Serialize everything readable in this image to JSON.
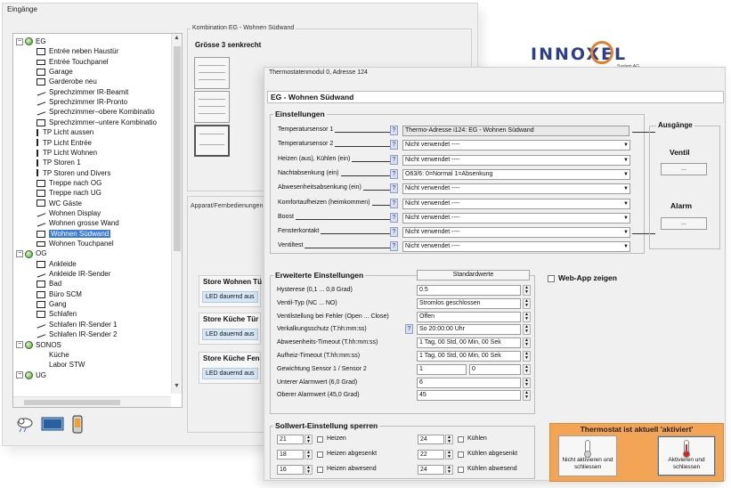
{
  "back_window": {
    "title": "Eingänge",
    "kombination_group_label": "Kombination EG - Wohnen Südwand",
    "kombination_subtitle": "Grösse 3 senkrecht",
    "apparat_group_label": "Apparat/Fernbedienungen",
    "tree": [
      {
        "label": "EG",
        "level": 0,
        "type": "group"
      },
      {
        "label": "Entrée neben Haustür",
        "level": 1,
        "type": "panel"
      },
      {
        "label": "Entrée Touchpanel",
        "level": 1,
        "type": "tp"
      },
      {
        "label": "Garage",
        "level": 1,
        "type": "panel"
      },
      {
        "label": "Garderobe neu",
        "level": 1,
        "type": "panel"
      },
      {
        "label": "Sprechzimmer IR-Beamit",
        "level": 1,
        "type": "line"
      },
      {
        "label": "Sprechzimmer IR-Pronto",
        "level": 1,
        "type": "line"
      },
      {
        "label": "Sprechzimmer–obere Kombinatio",
        "level": 1,
        "type": "line"
      },
      {
        "label": "Sprechzimmer–untere Kombinatio",
        "level": 1,
        "type": "panel"
      },
      {
        "label": "TP Licht aussen",
        "level": 1,
        "type": "bar"
      },
      {
        "label": "TP Licht Entrée",
        "level": 1,
        "type": "bar"
      },
      {
        "label": "TP Licht Wohnen",
        "level": 1,
        "type": "bar"
      },
      {
        "label": "TP Storen 1",
        "level": 1,
        "type": "bar"
      },
      {
        "label": "TP Storen und Divers",
        "level": 1,
        "type": "bar"
      },
      {
        "label": "Treppe nach OG",
        "level": 1,
        "type": "panel"
      },
      {
        "label": "Treppe nach UG",
        "level": 1,
        "type": "panel"
      },
      {
        "label": "WC Gäste",
        "level": 1,
        "type": "panel"
      },
      {
        "label": "Wohnen Display",
        "level": 1,
        "type": "line"
      },
      {
        "label": "Wohnen grosse Wand",
        "level": 1,
        "type": "line"
      },
      {
        "label": "Wohnen Südwand",
        "level": 1,
        "type": "panel",
        "selected": true
      },
      {
        "label": "Wohnen Touchpanel",
        "level": 1,
        "type": "tp"
      },
      {
        "label": "OG",
        "level": 0,
        "type": "group"
      },
      {
        "label": "Ankleide",
        "level": 1,
        "type": "panel"
      },
      {
        "label": "Ankleide IR-Sender",
        "level": 1,
        "type": "line"
      },
      {
        "label": "Bad",
        "level": 1,
        "type": "panel"
      },
      {
        "label": "Büro SCM",
        "level": 1,
        "type": "panel"
      },
      {
        "label": "Gang",
        "level": 1,
        "type": "panel"
      },
      {
        "label": "Schlafen",
        "level": 1,
        "type": "panel"
      },
      {
        "label": "Schlafen IR-Sender 1",
        "level": 1,
        "type": "line"
      },
      {
        "label": "Schlafen IR-Sender 2",
        "level": 1,
        "type": "line"
      },
      {
        "label": "SONOS",
        "level": 0,
        "type": "group"
      },
      {
        "label": "Küche",
        "level": 1,
        "type": "none"
      },
      {
        "label": "Labor STW",
        "level": 1,
        "type": "none"
      },
      {
        "label": "UG",
        "level": 0,
        "type": "group"
      }
    ],
    "store_cards": [
      {
        "title": "Store Wohnen Tü",
        "value": "LED dauernd aus"
      },
      {
        "title": "Store Küche Tür",
        "value": "LED dauernd aus"
      },
      {
        "title": "Store Küche Fen",
        "value": "LED dauernd aus"
      }
    ],
    "bottom_icons": [
      "weather-icon",
      "screen-icon",
      "phone-icon"
    ]
  },
  "logo": {
    "word": "INNOXEL",
    "sub": "System AG"
  },
  "front_window": {
    "title": "Thermostatenmodul 0, Adresse 124",
    "header": "EG - Wohnen Südwand",
    "einstellungen_label": "Einstellungen",
    "einstellungen": [
      {
        "label": "Temperatursensor 1",
        "value": "Thermo-Adresse i124: EG - Wohnen Südwand",
        "disabled": true
      },
      {
        "label": "Temperatursensor 2",
        "value": "Nicht verwendet ----"
      },
      {
        "label": "Heizen (aus), Kühlen (ein)",
        "value": "Nicht verwendet ----"
      },
      {
        "label": "Nachtabsenkung (ein)",
        "value": "O63/6: 0=Normal 1=Absenkung"
      },
      {
        "label": "Abwesenheitsabsenkung (ein)",
        "value": "Nicht verwendet ----"
      },
      {
        "label": "Komfortaufheizen (heimkommen)",
        "value": "Nicht verwendet ----"
      },
      {
        "label": "Boost",
        "value": "Nicht verwendet ----"
      },
      {
        "label": "Fensterkontakt",
        "value": "Nicht verwendet ----"
      },
      {
        "label": "Ventiltest",
        "value": "Nicht verwendet ----"
      }
    ],
    "ausgaenge_label": "Ausgänge",
    "ausgaenge": [
      {
        "label": "Ventil",
        "button": "..."
      },
      {
        "label": "Alarm",
        "button": "..."
      }
    ],
    "erweitert_label": "Erweiterte Einstellungen",
    "standard_button": "Standardwerte",
    "erweitert": [
      {
        "label": "Hysterese (0,1 ... 0,8 Grad)",
        "value": "0.5"
      },
      {
        "label": "Ventil-Typ (NC ... NO)",
        "value": "Stromlos geschlossen"
      },
      {
        "label": "Ventilstellung bei Fehler (Open ... Close)",
        "value": "Offen"
      },
      {
        "label": "Verkalkungsschutz (T.hh:mm:ss)",
        "value": "So 20:00:00 Uhr",
        "help": true
      },
      {
        "label": "Abwesenheits-Timeout (T.hh:mm:ss)",
        "value": "1 Tag, 00 Std, 00 Min, 00 Sek"
      },
      {
        "label": "Aufheiz-Timeout (T.hh:mm:ss)",
        "value": "1 Tag, 00 Std, 00 Min, 00 Sek"
      },
      {
        "label": "Gewichtung Sensor 1 / Sensor 2",
        "value": "1",
        "value2": "0"
      },
      {
        "label": "Unterer Alarmwert (6,0 Grad)",
        "value": "6"
      },
      {
        "label": "Oberer Alarmwert (45,0 Grad)",
        "value": "45"
      }
    ],
    "webapp_label": "Web-App zeigen",
    "sperren_label": "Sollwert-Einstellung sperren",
    "sperren": [
      {
        "num": "21",
        "text": "Heizen"
      },
      {
        "num": "24",
        "text": "Kühlen"
      },
      {
        "num": "18",
        "text": "Heizen abgesenkt"
      },
      {
        "num": "22",
        "text": "Kühlen abgesenkt"
      },
      {
        "num": "16",
        "text": "Heizen abwesend"
      },
      {
        "num": "24",
        "text": "Kühlen abwesend"
      }
    ],
    "thermostat_title": "Thermostat ist aktuell 'aktiviert'",
    "btn_deactivate": "Nicht aktivieren und schliessen",
    "btn_activate": "Aktivieren und schliessen"
  },
  "colors": {
    "accent_orange": "#f4a455",
    "selection_blue": "#3a7bd5",
    "logo_blue": "#2e3f8a"
  }
}
